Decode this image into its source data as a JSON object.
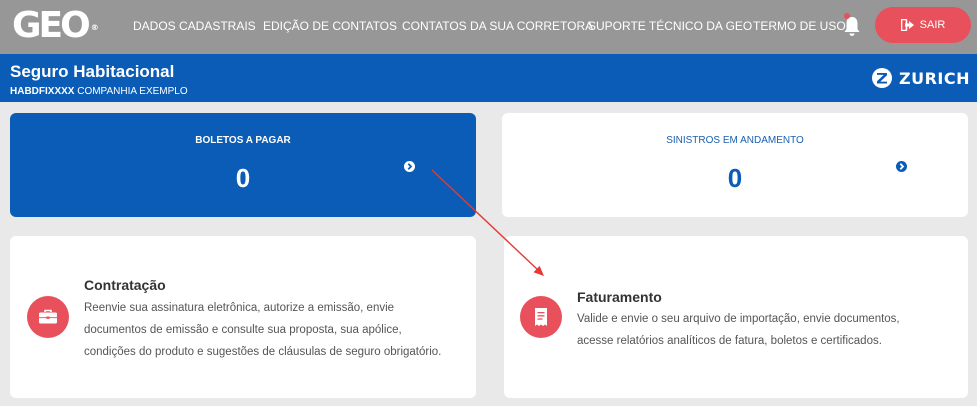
{
  "topbar": {
    "logo": "GEO",
    "logo_mark": "®",
    "nav": [
      "DADOS CADASTRAIS",
      "EDIÇÃO DE CONTATOS",
      "CONTATOS DA SUA CORRETORA",
      "SUPORTE TÉCNICO DA GEO",
      "TERMO DE USO"
    ],
    "logout_label": "SAIR",
    "icons": {
      "bell": "bell-icon",
      "logout": "logout-icon"
    }
  },
  "header": {
    "title": "Seguro Habitacional",
    "code": "HABDFIXXXX",
    "company": " COMPANHIA EXEMPLO",
    "insurer": "ZURICH"
  },
  "cards": [
    {
      "title": "BOLETOS A PAGAR",
      "value": "0"
    },
    {
      "title": "SINISTROS EM ANDAMENTO",
      "value": "0"
    }
  ],
  "services": [
    {
      "title": "Contratação",
      "lines": [
        "Reenvie sua assinatura eletrônica, autorize a emissão, envie",
        "documentos de emissão e consulte sua proposta, sua apólice,",
        "condições do produto e sugestões de cláusulas de seguro obrigatório."
      ],
      "icon": "briefcase-icon"
    },
    {
      "title": "Faturamento",
      "lines": [
        "Valide e envie o seu arquivo de importação, envie documentos,",
        "acesse relatórios analíticos de fatura, boletos e certificados."
      ],
      "icon": "receipt-icon"
    }
  ],
  "colors": {
    "accent": "#0b5cb6",
    "danger": "#e8505b",
    "topbar": "#979797",
    "background": "#e9e9e9"
  }
}
